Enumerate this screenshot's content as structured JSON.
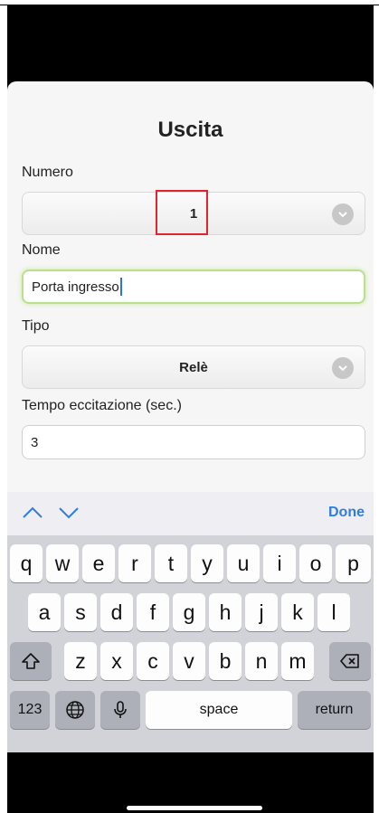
{
  "form": {
    "title": "Uscita",
    "numero_label": "Numero",
    "numero_value": "1",
    "nome_label": "Nome",
    "nome_value": "Porta ingresso",
    "tipo_label": "Tipo",
    "tipo_value": "Relè",
    "tempo_label": "Tempo eccitazione (sec.)",
    "tempo_value": "3"
  },
  "toolbar": {
    "prev_icon": "chevron-up-icon",
    "next_icon": "chevron-down-icon",
    "done_label": "Done"
  },
  "keyboard": {
    "row1": [
      "q",
      "w",
      "e",
      "r",
      "t",
      "y",
      "u",
      "i",
      "o",
      "p"
    ],
    "row2": [
      "a",
      "s",
      "d",
      "f",
      "g",
      "h",
      "j",
      "k",
      "l"
    ],
    "row3": [
      "z",
      "x",
      "c",
      "v",
      "b",
      "n",
      "m"
    ],
    "numbers_label": "123",
    "space_label": "space",
    "return_label": "return",
    "icons": [
      "shift-icon",
      "backspace-icon",
      "globe-icon",
      "microphone-icon"
    ]
  },
  "colors": {
    "accent": "#2f7de1",
    "highlight_box": "#e0262c",
    "focus_glow": "#b9e08a"
  }
}
